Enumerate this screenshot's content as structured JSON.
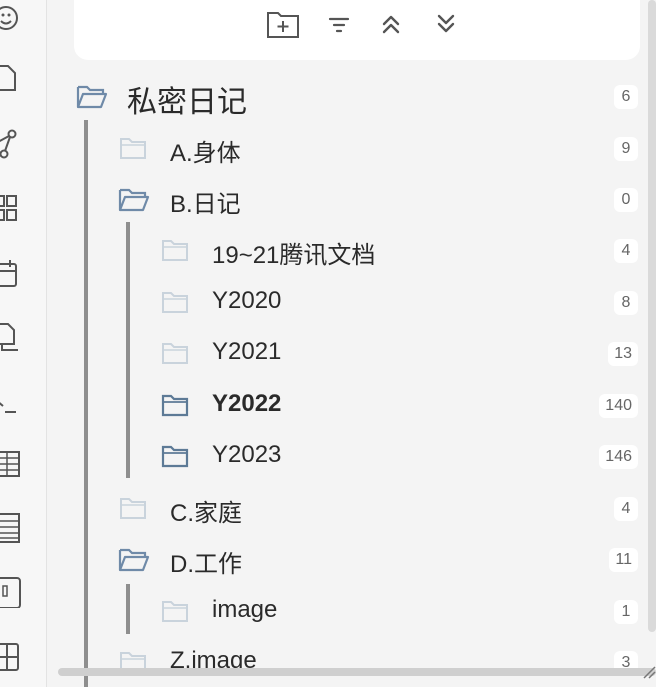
{
  "toolbar": {
    "buttons": [
      {
        "name": "new-folder",
        "icon": "folder-plus-icon"
      },
      {
        "name": "sort",
        "icon": "sort-icon"
      },
      {
        "name": "collapse-all",
        "icon": "chevrons-up-icon"
      },
      {
        "name": "expand-all",
        "icon": "chevrons-down-icon"
      }
    ]
  },
  "ribbon": {
    "icons": [
      "smiley-icon",
      "file-icon",
      "graph-icon",
      "grid-icon",
      "calendar-icon",
      "copy-icon",
      "terminal-icon",
      "table-icon",
      "list-icon",
      "slides-icon",
      "layout-icon"
    ]
  },
  "tree": {
    "root": {
      "label": "私密日记",
      "count": "6"
    },
    "items": [
      {
        "label": "A.身体",
        "count": "9"
      },
      {
        "label": "B.日记",
        "count": "0"
      },
      {
        "label": "19~21腾讯文档",
        "count": "4"
      },
      {
        "label": "Y2020",
        "count": "8"
      },
      {
        "label": "Y2021",
        "count": "13"
      },
      {
        "label": "Y2022",
        "count": "140"
      },
      {
        "label": "Y2023",
        "count": "146"
      },
      {
        "label": "C.家庭",
        "count": "4"
      },
      {
        "label": "D.工作",
        "count": "11"
      },
      {
        "label": "image",
        "count": "1"
      },
      {
        "label": "Z.image",
        "count": "3"
      }
    ]
  },
  "colors": {
    "folder_open": "#6f8aa8",
    "folder_dark": "#5d7a96",
    "folder_light": "#c9d3dc",
    "guide": "#8e8e8e"
  }
}
